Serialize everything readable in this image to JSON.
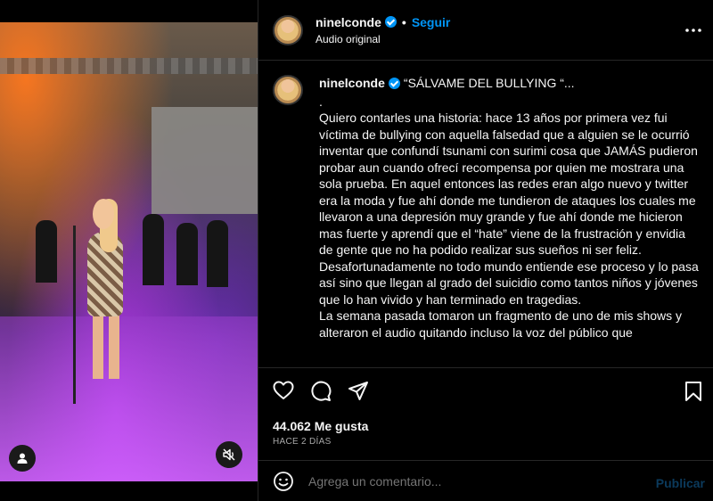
{
  "media": {
    "avatar_icon": "user-icon",
    "mute_icon": "muted-speaker-icon"
  },
  "header": {
    "username": "ninelconde",
    "separator": "•",
    "follow_label": "Seguir",
    "audio_label": "Audio original",
    "more_icon": "more-options-icon"
  },
  "caption": {
    "username": "ninelconde",
    "title": "“SÁLVAME DEL BULLYING “...",
    "body": ".\nQuiero contarles una historia: hace 13 años por primera vez fui víctima de bullying con aquella falsedad que a alguien se le ocurrió inventar que confundí tsunami con surimi cosa que JAMÁS pudieron probar aun cuando ofrecí recompensa por quien me mostrara una sola prueba. En aquel entonces las redes eran algo nuevo y twitter era la moda y fue ahí donde me tundieron de ataques los cuales me llevaron a una depresión muy grande y fue ahí donde me hicieron mas fuerte y aprendí que el “hate” viene de la frustración y envidia de gente que no ha podido realizar sus sueños ni ser feliz. Desafortunadamente no todo mundo entiende ese proceso y lo pasa así sino que llegan al grado del suicidio como tantos niños y jóvenes que lo han vivido y han terminado en tragedias.\nLa semana pasada tomaron un fragmento de uno de mis shows y alteraron el audio quitando incluso la voz del público que"
  },
  "actions": {
    "like_icon": "heart-icon",
    "comment_icon": "comment-icon",
    "share_icon": "send-icon",
    "save_icon": "bookmark-icon"
  },
  "stats": {
    "likes": "44.062 Me gusta",
    "time": "HACE 2 DÍAS"
  },
  "comment": {
    "emoji_icon": "emoji-icon",
    "placeholder": "Agrega un comentario...",
    "publish_label": "Publicar"
  }
}
